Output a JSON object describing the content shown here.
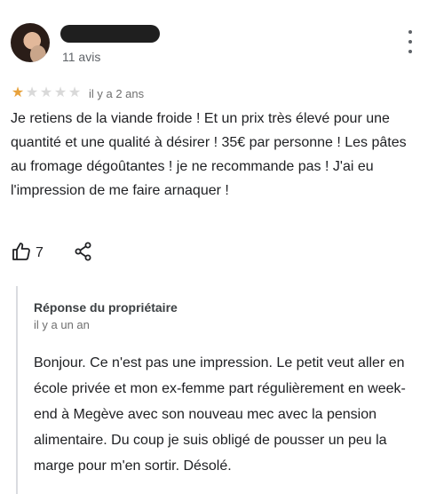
{
  "reviewer": {
    "review_count": "11 avis"
  },
  "review": {
    "rating": 1,
    "rating_max": 5,
    "time": "il y a 2 ans",
    "text": "Je retiens de la viande froide ! Et un prix très élevé pour une quantité et une qualité à désirer ! 35€ par personne ! Les pâtes au fromage dégoûtantes ! je ne recommande pas ! J'ai eu l'impression de me faire arnaquer !",
    "likes": "7"
  },
  "owner_reply": {
    "title": "Réponse du propriétaire",
    "time": "il y a un an",
    "text": "Bonjour. Ce n'est pas une impression. Le petit veut aller en école privée et mon ex-femme part régulièrement en week-end à Megève avec son nouveau mec avec la pension alimentaire. Du coup je suis obligé de pousser un peu la marge pour m'en sortir. Désolé."
  },
  "colors": {
    "star_filled": "#e8a23c",
    "star_empty": "#d9d9d9",
    "muted_text": "#6f6f6f",
    "reply_border": "#dadce0"
  },
  "icons": {
    "menu": "more-vert-icon",
    "like": "thumbs-up-icon",
    "share": "share-icon",
    "star": "star-icon"
  }
}
